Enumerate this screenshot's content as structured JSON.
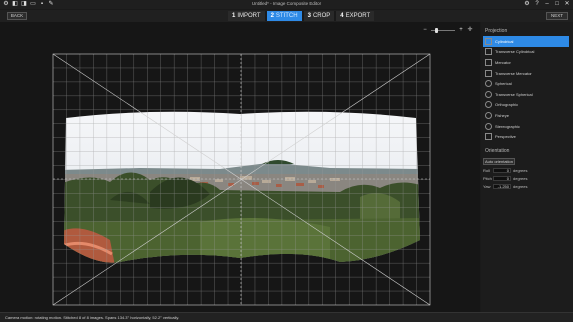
{
  "window": {
    "title": "Untitled* - Image Composite Editor"
  },
  "toolbar": {
    "icons": [
      "settings-icon",
      "new-panorama-icon",
      "new-video-panorama-icon",
      "open-icon",
      "save-icon",
      "export-icon"
    ]
  },
  "window_controls": {
    "icons": [
      "gear-icon",
      "help-icon",
      "minimize-icon",
      "maximize-icon",
      "close-icon"
    ]
  },
  "steps": {
    "back_label": "BACK",
    "next_label": "NEXT",
    "items": [
      {
        "num": "1",
        "label": "IMPORT"
      },
      {
        "num": "2",
        "label": "STITCH"
      },
      {
        "num": "3",
        "label": "CROP"
      },
      {
        "num": "4",
        "label": "EXPORT"
      }
    ],
    "active": "STITCH"
  },
  "zoom": {
    "minus": "−",
    "plus": "+",
    "fit": "✛",
    "level": 0.2
  },
  "projection": {
    "title": "Projection",
    "items": [
      {
        "label": "Cylindrical",
        "icon": "cylindrical-icon",
        "selected": true
      },
      {
        "label": "Transverse Cylindrical",
        "icon": "transverse-cylindrical-icon"
      },
      {
        "label": "Mercator",
        "icon": "mercator-icon"
      },
      {
        "label": "Transverse Mercator",
        "icon": "transverse-mercator-icon"
      },
      {
        "label": "Spherical",
        "icon": "spherical-icon"
      },
      {
        "label": "Transverse Spherical",
        "icon": "transverse-spherical-icon"
      },
      {
        "label": "Orthographic",
        "icon": "orthographic-icon"
      },
      {
        "label": "Fisheye",
        "icon": "fisheye-icon"
      },
      {
        "label": "Stereographic",
        "icon": "stereographic-icon"
      },
      {
        "label": "Perspective",
        "icon": "perspective-icon"
      }
    ]
  },
  "orientation": {
    "title": "Orientation",
    "auto_label": "Auto orientation",
    "rows": [
      {
        "label": "Roll",
        "value": "0",
        "unit": "degrees"
      },
      {
        "label": "Pitch",
        "value": "0",
        "unit": "degrees"
      },
      {
        "label": "Yaw",
        "value": "-1.250",
        "unit": "degrees"
      }
    ]
  },
  "status": {
    "text": "Camera motion: rotating motion. Stitched 8 of 8 images. Spans 134.3° horizontally, 52.2° vertically."
  },
  "colors": {
    "accent": "#2e8ae6",
    "background": "#1a1a1a"
  }
}
